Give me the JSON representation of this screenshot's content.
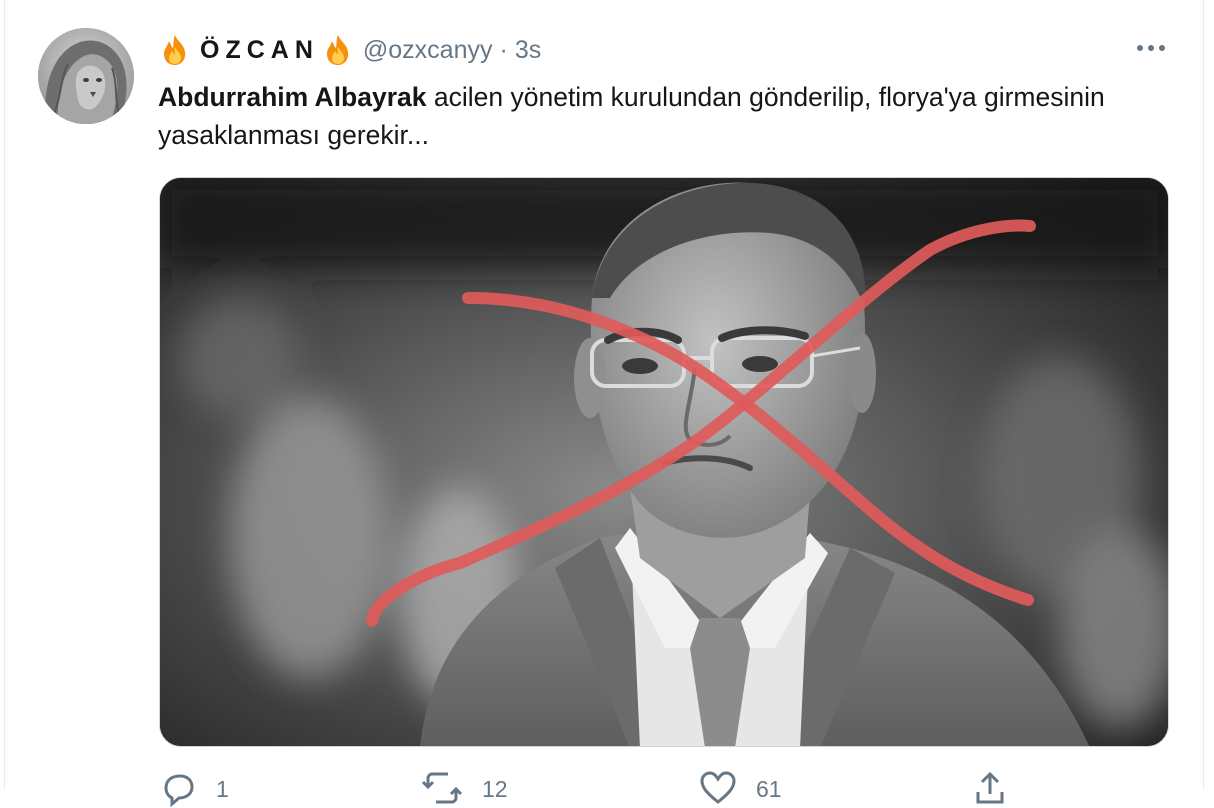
{
  "tweet": {
    "display_name": "ÖZCAN",
    "handle": "@ozxcanyy",
    "separator": "·",
    "timestamp": "3s",
    "text_bold": "Abdurrahim Albayrak",
    "text_rest": " acilen yönetim kurulundan gönderilip, florya'ya girmesinin yasaklanması gerekir...",
    "name_emoji_icon": "fire-icon",
    "more_icon": "more-icon"
  },
  "actions": {
    "reply_count": "1",
    "retweet_count": "12",
    "like_count": "61",
    "share_count": ""
  },
  "colors": {
    "text_primary": "#14171a",
    "text_secondary": "#657786",
    "border": "#ccd6dd",
    "cross_mark": "#e05a5a"
  }
}
